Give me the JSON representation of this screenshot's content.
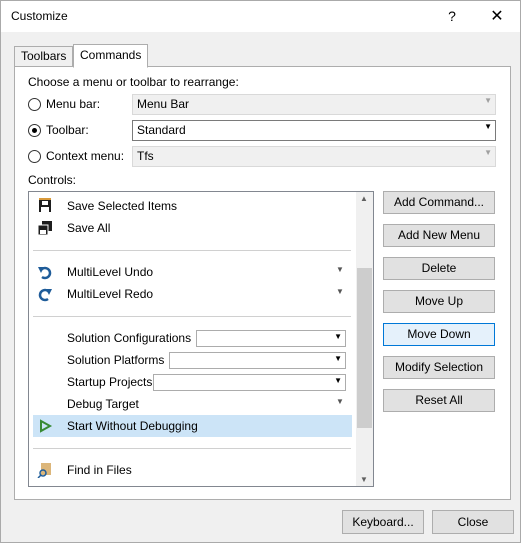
{
  "window": {
    "title": "Customize",
    "help_glyph": "?",
    "close_glyph": "✕"
  },
  "tabs": [
    {
      "label": "Toolbars"
    },
    {
      "label": "Commands"
    }
  ],
  "choose_label": "Choose a menu or toolbar to rearrange:",
  "options": {
    "menu_bar": {
      "label": "Menu bar:",
      "value": "Menu Bar",
      "selected": false
    },
    "toolbar": {
      "label": "Toolbar:",
      "value": "Standard",
      "selected": true
    },
    "context_menu": {
      "label": "Context menu:",
      "value": "Tfs",
      "selected": false
    }
  },
  "controls_label": "Controls:",
  "controls": {
    "save_selected": "Save Selected Items",
    "save_all": "Save All",
    "multilevel_undo": "MultiLevel Undo",
    "multilevel_redo": "MultiLevel Redo",
    "solution_configurations": "Solution Configurations",
    "solution_platforms": "Solution Platforms",
    "startup_projects": "Startup Projects",
    "debug_target": "Debug Target",
    "start_without_debugging": "Start Without Debugging",
    "find_in_files": "Find in Files"
  },
  "buttons": {
    "add_command": "Add Command...",
    "add_new_menu": "Add New Menu",
    "delete": "Delete",
    "move_up": "Move Up",
    "move_down": "Move Down",
    "modify_selection": "Modify Selection",
    "reset_all": "Reset All",
    "keyboard": "Keyboard...",
    "close": "Close"
  },
  "colors": {
    "selection": "#cce4f7",
    "accent": "#0078d7",
    "save_icon": "#1e1e1e",
    "undo_icon": "#1f5c99",
    "play_icon": "#388a34"
  }
}
